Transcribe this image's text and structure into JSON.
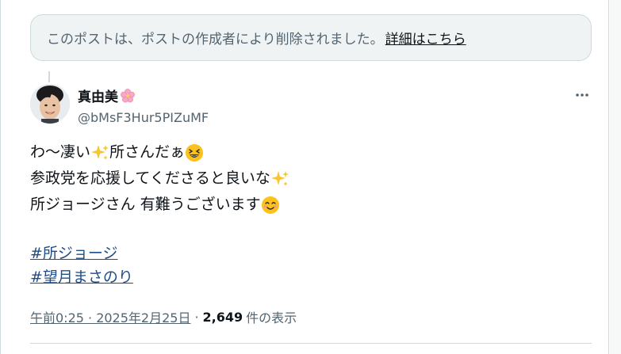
{
  "notice": {
    "text": "このポストは、ポストの作成者により削除されました。",
    "link_label": "詳細はこちら"
  },
  "author": {
    "name": "真由美",
    "name_icon": "cherry-blossom-icon",
    "handle": "@bMsF3Hur5PIZuMF"
  },
  "tweet": {
    "line1": "わ〜凄い",
    "line1b": "所さんだぁ",
    "line2": "参政党を応援してくださると良いな",
    "line3": "所ジョージさん 有難うございます",
    "hashtags": [
      "#所ジョージ",
      "#望月まさのり"
    ]
  },
  "meta": {
    "time": "午前0:25 · 2025年2月25日",
    "separator": "·",
    "views_count": "2,649",
    "views_label": "件の表示"
  },
  "colors": {
    "hashtag": "#1d4d8b",
    "secondary": "#536471",
    "notice_bg": "#eff3f4",
    "border": "#cfd9de"
  }
}
